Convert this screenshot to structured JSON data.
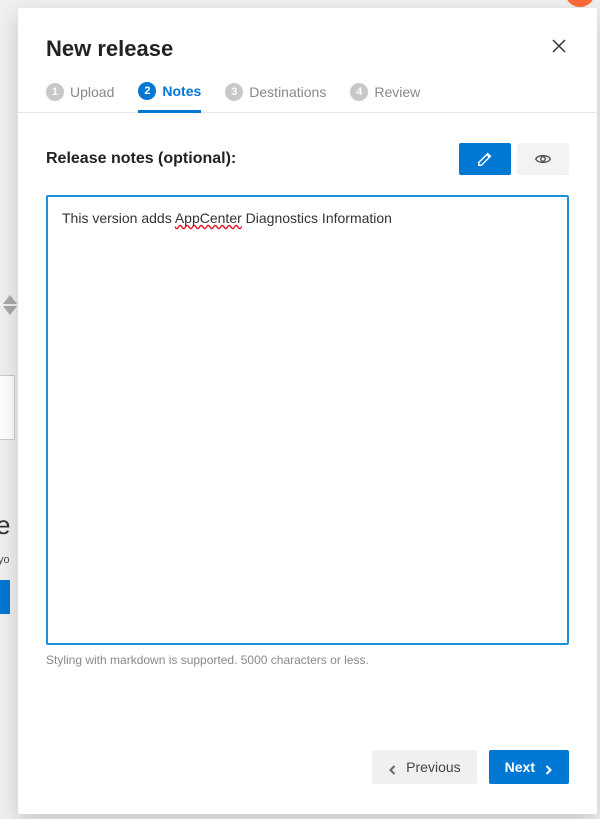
{
  "dialog": {
    "title": "New release"
  },
  "stepper": {
    "items": [
      {
        "num": "1",
        "label": "Upload"
      },
      {
        "num": "2",
        "label": "Notes"
      },
      {
        "num": "3",
        "label": "Destinations"
      },
      {
        "num": "4",
        "label": "Review"
      }
    ],
    "active_index": 1
  },
  "notes": {
    "label": "Release notes (optional):",
    "value_prefix": "This version adds ",
    "value_spellcheck": "AppCenter",
    "value_suffix": " Diagnostics Information",
    "helper": "Styling with markdown is supported. 5000 characters or less."
  },
  "footer": {
    "previous": "Previous",
    "next": "Next"
  },
  "background": {
    "letter": "e",
    "sub": "yo"
  }
}
